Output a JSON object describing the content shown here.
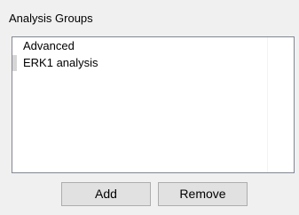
{
  "group": {
    "title": "Analysis Groups"
  },
  "list": {
    "items": [
      {
        "label": "Advanced"
      },
      {
        "label": "ERK1 analysis"
      }
    ]
  },
  "buttons": {
    "add_label": "Add",
    "remove_label": "Remove"
  }
}
